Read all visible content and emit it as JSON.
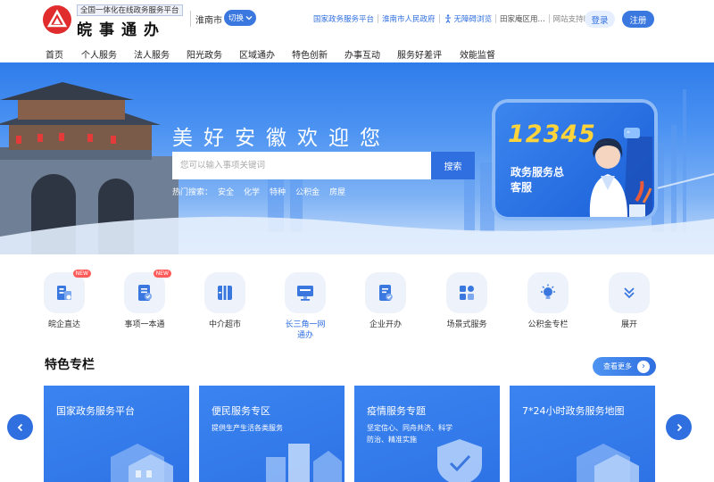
{
  "header": {
    "logo_subtitle": "全国一体化在线政务服务平台",
    "logo_title": "皖事通办",
    "city": "淮南市",
    "switch_label": "切换",
    "links": [
      {
        "label": "国家政务服务平台"
      },
      {
        "label": "淮南市人民政府"
      },
      {
        "label": "无障碍浏览"
      },
      {
        "label": "田家庵区用..."
      },
      {
        "label": "网站支持IPv6"
      }
    ],
    "login_label": "登录",
    "register_label": "注册"
  },
  "nav": {
    "items": [
      "首页",
      "个人服务",
      "法人服务",
      "阳光政务",
      "区域通办",
      "特色创新",
      "办事互动",
      "服务好差评",
      "效能监督"
    ]
  },
  "hero": {
    "title": "美好安徽欢迎您",
    "search_placeholder": "您可以输入事项关键词",
    "search_button": "搜索",
    "hot_label": "热门搜索：",
    "hot_terms": [
      "安全",
      "化学",
      "特种",
      "公积金",
      "房屋"
    ],
    "promo_number": "12345",
    "promo_text": "政务服务总客服"
  },
  "services": [
    {
      "label": "皖企直达",
      "icon": "enterprise-icon",
      "tag": "NEW"
    },
    {
      "label": "事项一本通",
      "icon": "checklist-icon",
      "tag": "NEW"
    },
    {
      "label": "中介超市",
      "icon": "market-icon",
      "tag": ""
    },
    {
      "label": "长三角一网通办",
      "icon": "screen-icon",
      "tag": ""
    },
    {
      "label": "企业开办",
      "icon": "document-check-icon",
      "tag": ""
    },
    {
      "label": "场景式服务",
      "icon": "grid-icon",
      "tag": ""
    },
    {
      "label": "公积金专栏",
      "icon": "lightbulb-icon",
      "tag": ""
    },
    {
      "label": "展开",
      "icon": "chevron-double-down-icon",
      "tag": ""
    }
  ],
  "featured": {
    "title": "特色专栏",
    "more_label": "查看更多",
    "cards": [
      {
        "title": "国家政务服务平台",
        "desc": ""
      },
      {
        "title": "便民服务专区",
        "desc": "提供生产生活各类服务"
      },
      {
        "title": "疫情服务专题",
        "desc": "坚定信心、同舟共济、科学防治、精准实施"
      },
      {
        "title": "7*24小时政务服务地图",
        "desc": ""
      }
    ]
  },
  "colors": {
    "primary": "#2f6fe0",
    "logo_red": "#e02c2c",
    "promo_yellow": "#ffd43b"
  }
}
